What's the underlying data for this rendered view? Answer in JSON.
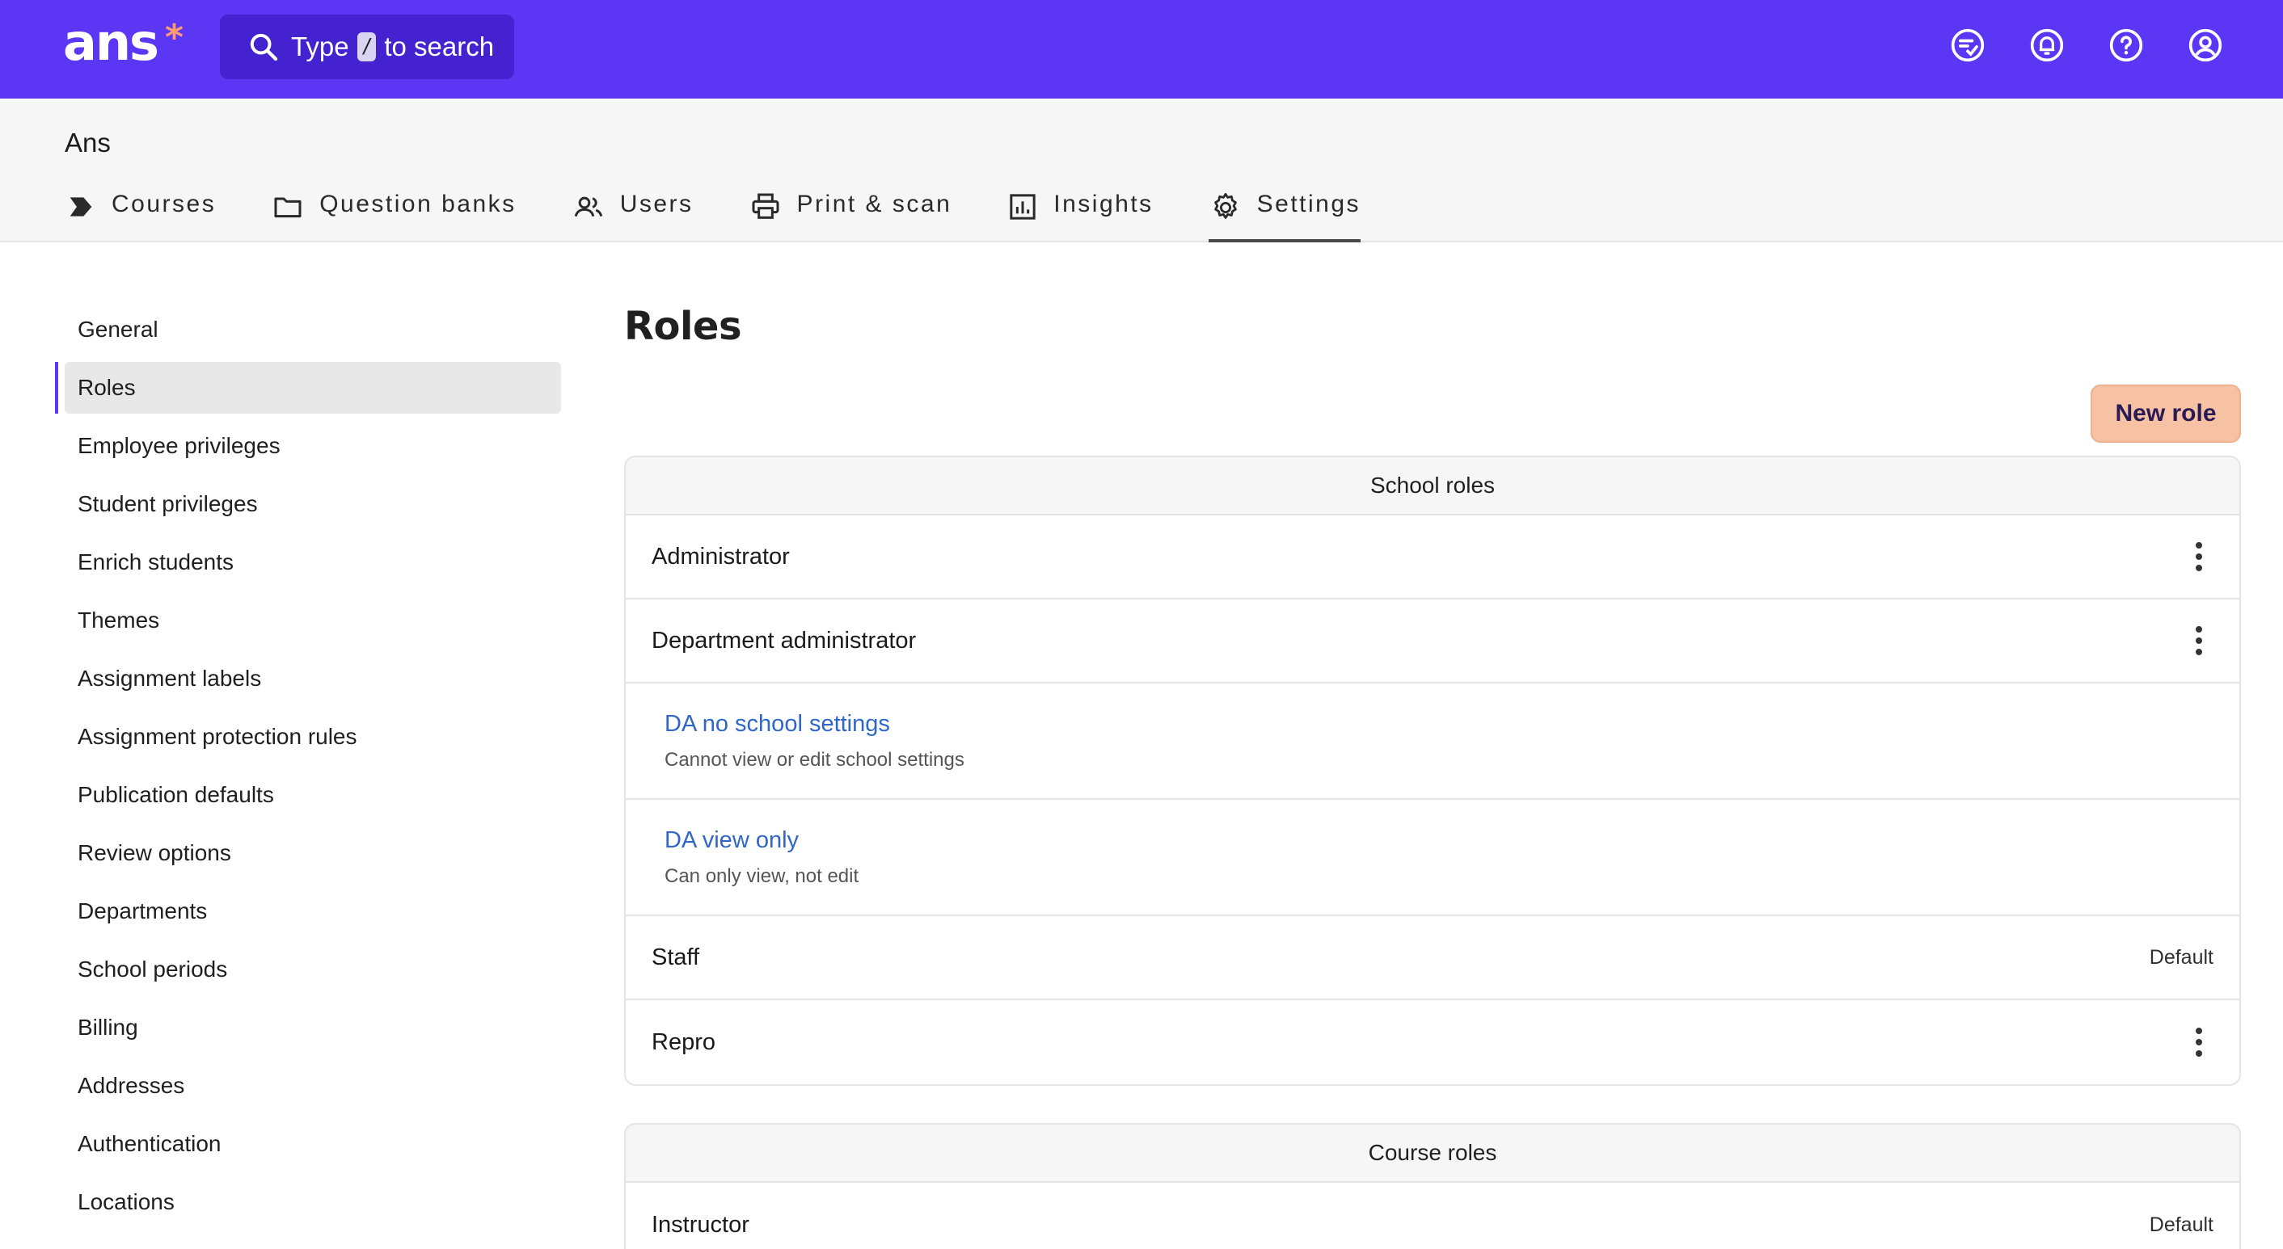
{
  "brand": {
    "logo": "ans",
    "star": "*"
  },
  "search": {
    "prefix": "Type",
    "key": "/",
    "suffix": "to search"
  },
  "header_icons": [
    "tasks-icon",
    "bell-icon",
    "help-icon",
    "user-icon"
  ],
  "org_name": "Ans",
  "nav": [
    {
      "label": "Courses",
      "icon": "chevron-tag-icon",
      "active": false
    },
    {
      "label": "Question banks",
      "icon": "folder-icon",
      "active": false
    },
    {
      "label": "Users",
      "icon": "users-icon",
      "active": false
    },
    {
      "label": "Print & scan",
      "icon": "printer-icon",
      "active": false
    },
    {
      "label": "Insights",
      "icon": "chart-icon",
      "active": false
    },
    {
      "label": "Settings",
      "icon": "gear-icon",
      "active": true
    }
  ],
  "sidebar": {
    "items": [
      "General",
      "Roles",
      "Employee privileges",
      "Student privileges",
      "Enrich students",
      "Themes",
      "Assignment labels",
      "Assignment protection rules",
      "Publication defaults",
      "Review options",
      "Departments",
      "School periods",
      "Billing",
      "Addresses",
      "Authentication",
      "Locations"
    ],
    "active_index": 1
  },
  "main": {
    "title": "Roles",
    "new_role_label": "New role",
    "school_roles": {
      "header": "School roles",
      "administrator": "Administrator",
      "department_admin": "Department administrator",
      "da_no_settings": {
        "title": "DA no school settings",
        "desc": "Cannot view or edit school settings"
      },
      "da_view_only": {
        "title": "DA view only",
        "desc": "Can only view, not edit"
      },
      "staff": "Staff",
      "staff_badge": "Default",
      "repro": "Repro"
    },
    "course_roles": {
      "header": "Course roles",
      "instructor": "Instructor",
      "instructor_badge": "Default"
    }
  },
  "colors": {
    "brand": "#5b36f5",
    "accent": "#f7c1a3",
    "link": "#2f67c9"
  }
}
